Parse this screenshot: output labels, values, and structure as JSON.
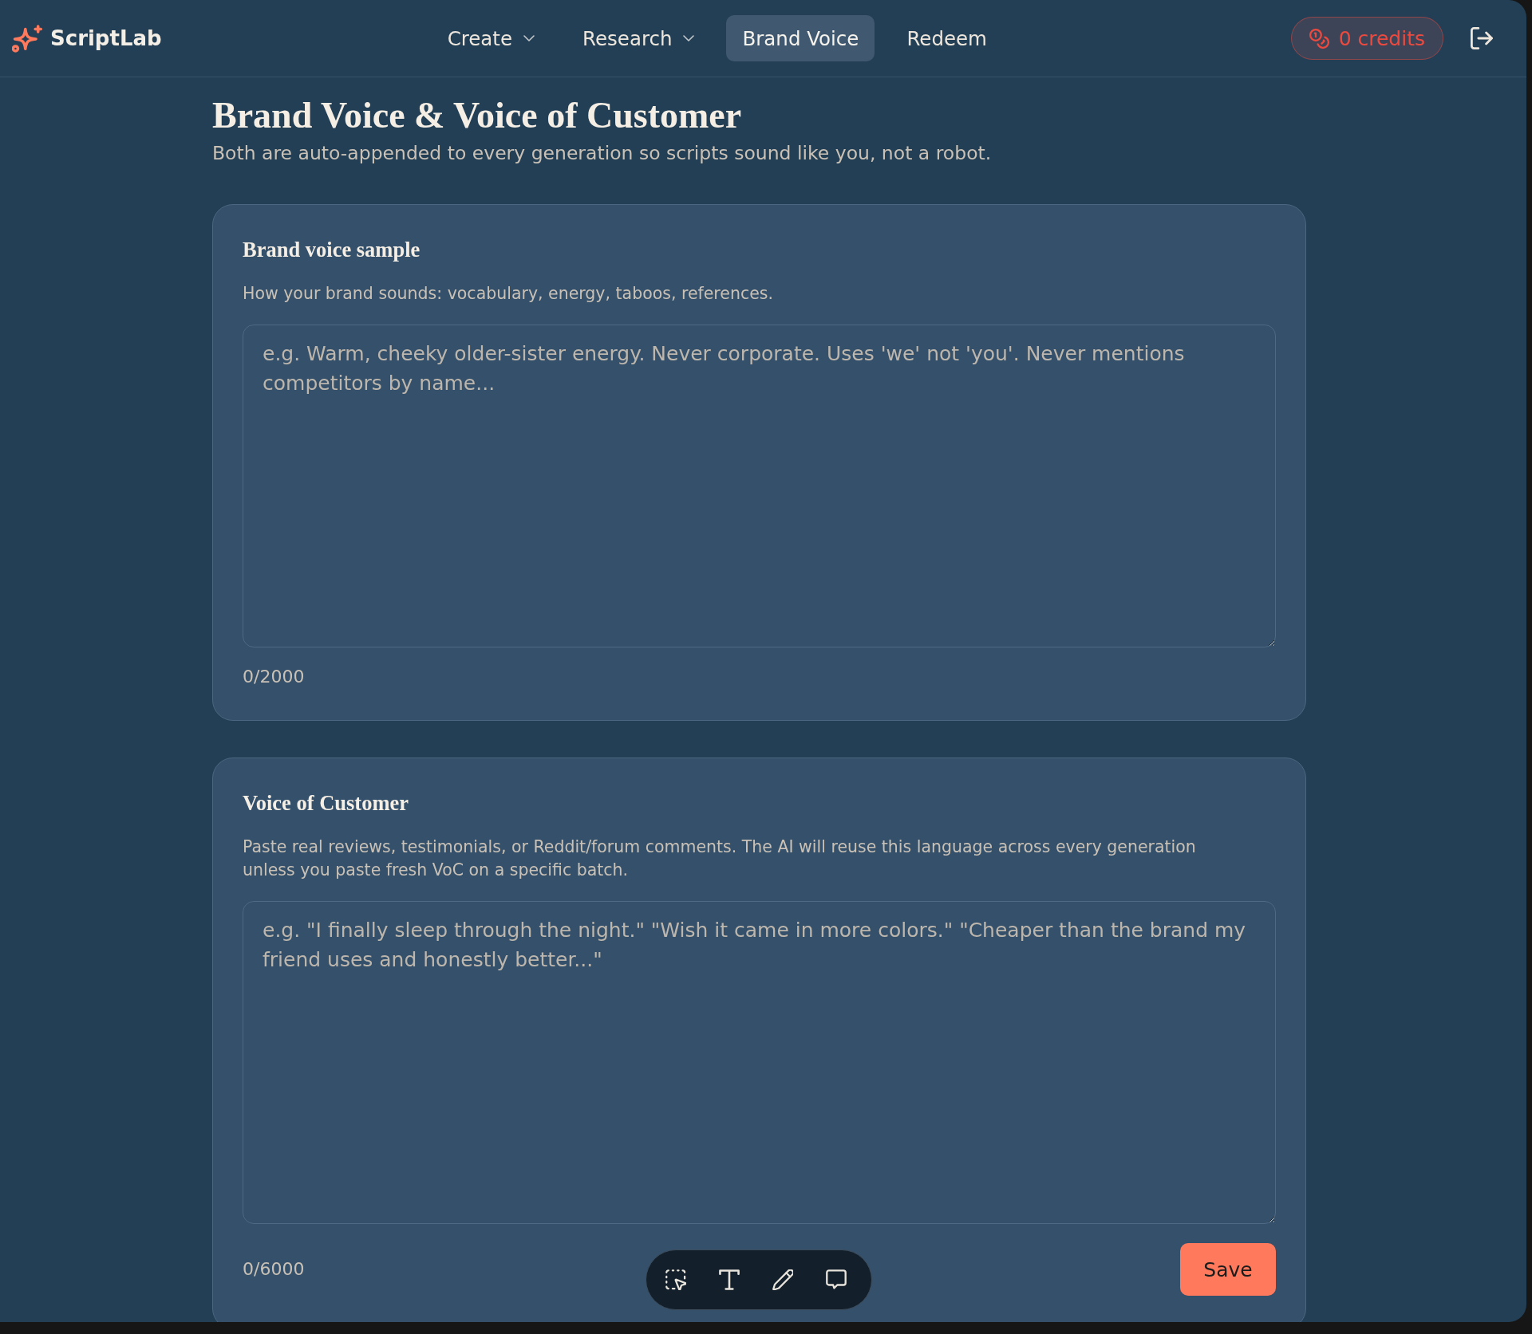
{
  "app": {
    "name": "ScriptLab"
  },
  "nav": [
    {
      "label": "Create",
      "kind": "dropdown",
      "selected": false
    },
    {
      "label": "Research",
      "kind": "dropdown",
      "selected": false
    },
    {
      "label": "Brand Voice",
      "kind": "link",
      "selected": true
    },
    {
      "label": "Redeem",
      "kind": "link",
      "selected": false
    }
  ],
  "credits": {
    "label": "0 credits"
  },
  "page": {
    "title": "Brand Voice & Voice of Customer",
    "subtitle": "Both are auto-appended to every generation so scripts sound like you, not a robot."
  },
  "sections": [
    {
      "title": "Brand voice sample",
      "help": "How your brand sounds: vocabulary, energy, taboos, references.",
      "placeholder": "e.g. Warm, cheeky older-sister energy. Never corporate. Uses 'we' not 'you'. Never mentions competitors by name...",
      "counter": "0/2000"
    },
    {
      "title": "Voice of Customer",
      "help": "Paste real reviews, testimonials, or Reddit/forum comments. The AI will reuse this language across every generation unless you paste fresh VoC on a specific batch.",
      "placeholder": "e.g. \"I finally sleep through the night.\" \"Wish it came in more colors.\" \"Cheaper than the brand my friend uses and honestly better...\"",
      "counter": "0/6000",
      "action": "Save"
    }
  ]
}
